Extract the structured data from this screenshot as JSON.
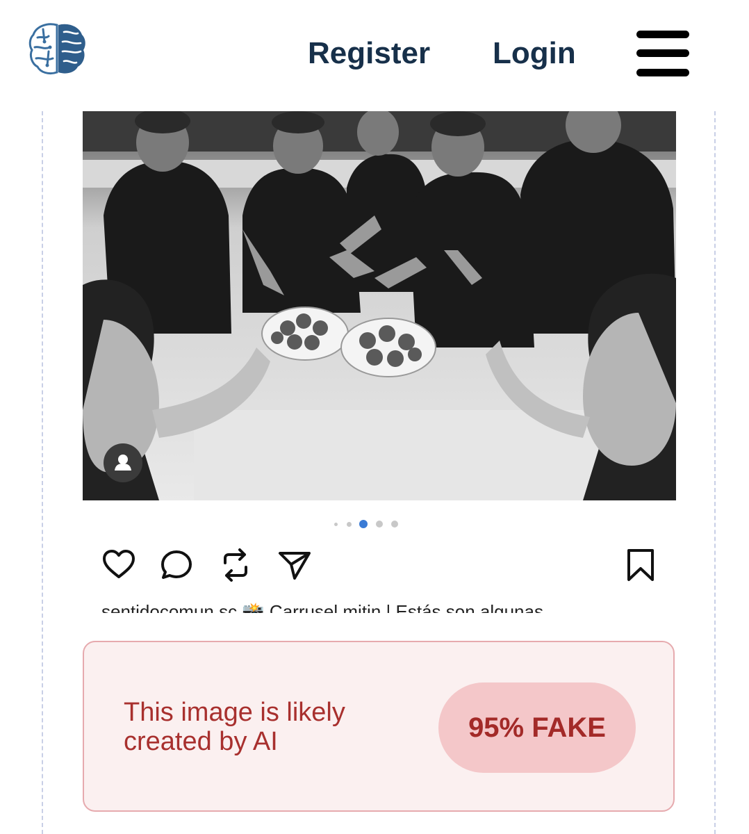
{
  "header": {
    "logo_icon": "brain-icon",
    "register_label": "Register",
    "login_label": "Login",
    "menu_icon": "hamburger-menu-icon"
  },
  "post": {
    "image_description_icon": "photo",
    "user_badge_icon": "person-icon",
    "carousel": {
      "total_dots": 5,
      "active_index": 2,
      "active_color": "#3a7bd5"
    },
    "actions": [
      "heart-icon",
      "comment-icon",
      "repost-icon",
      "share-icon",
      "bookmark-icon"
    ],
    "caption": "sentidocomun.sc 📸 Carrusel mitin | Estás son algunas"
  },
  "verdict": {
    "message": "This image is likely created by AI",
    "badge": "95% FAKE",
    "colors": {
      "text": "#a8302e",
      "background": "#fbf0f0",
      "border": "#e6aaae",
      "badge_bg": "#f4c7c9"
    }
  }
}
